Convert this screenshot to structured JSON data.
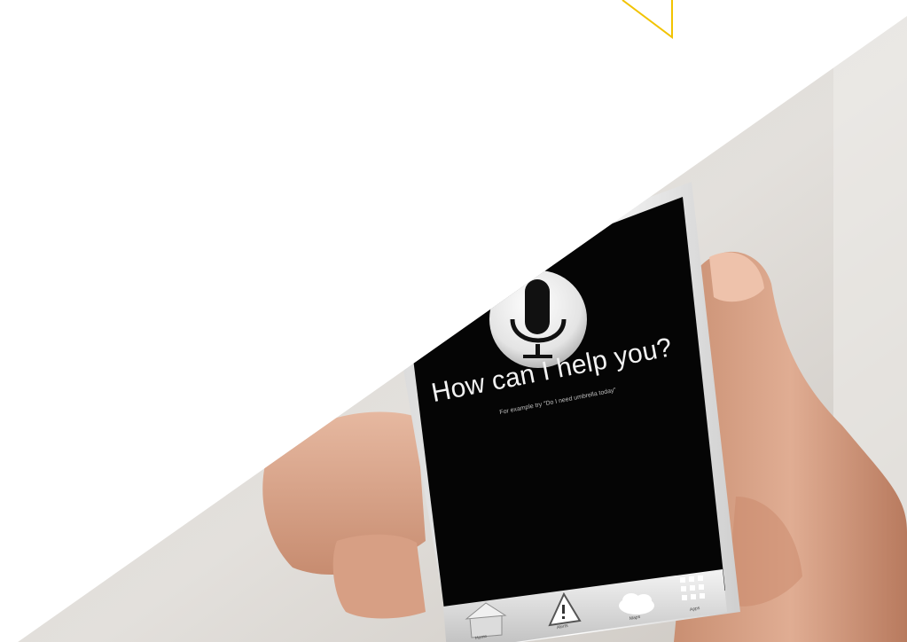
{
  "scene": {
    "type": "photo",
    "accent_color": "#f2c300",
    "background_color": "#ffffff"
  },
  "phone_screen": {
    "prompt": "How can I help you?",
    "hint": "For example try \"Do I need umbrella today\"",
    "mic_icon": "microphone-icon",
    "tabs": [
      {
        "icon": "home-icon",
        "label": "Home"
      },
      {
        "icon": "warning-icon",
        "label": "Alerts"
      },
      {
        "icon": "cloud-icon",
        "label": "Maps"
      },
      {
        "icon": "grid-icon",
        "label": "Apps"
      }
    ]
  }
}
